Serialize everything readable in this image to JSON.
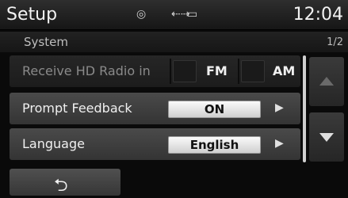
{
  "header": {
    "title": "Setup",
    "clock": "12:04",
    "status_icons": [
      "disc-icon",
      "usb-icon",
      "battery-icon"
    ]
  },
  "section": {
    "title": "System",
    "page_indicator": "1/2"
  },
  "rows": {
    "receive": {
      "label": "Receive HD Radio in",
      "options": [
        "FM",
        "AM"
      ]
    },
    "prompt": {
      "label": "Prompt Feedback",
      "value": "ON"
    },
    "language": {
      "label": "Language",
      "value": "English"
    }
  },
  "nav": {
    "scroll_up_icon": "chevron-up-icon",
    "scroll_down_icon": "chevron-down-icon",
    "back_icon": "back-arrow-icon"
  }
}
